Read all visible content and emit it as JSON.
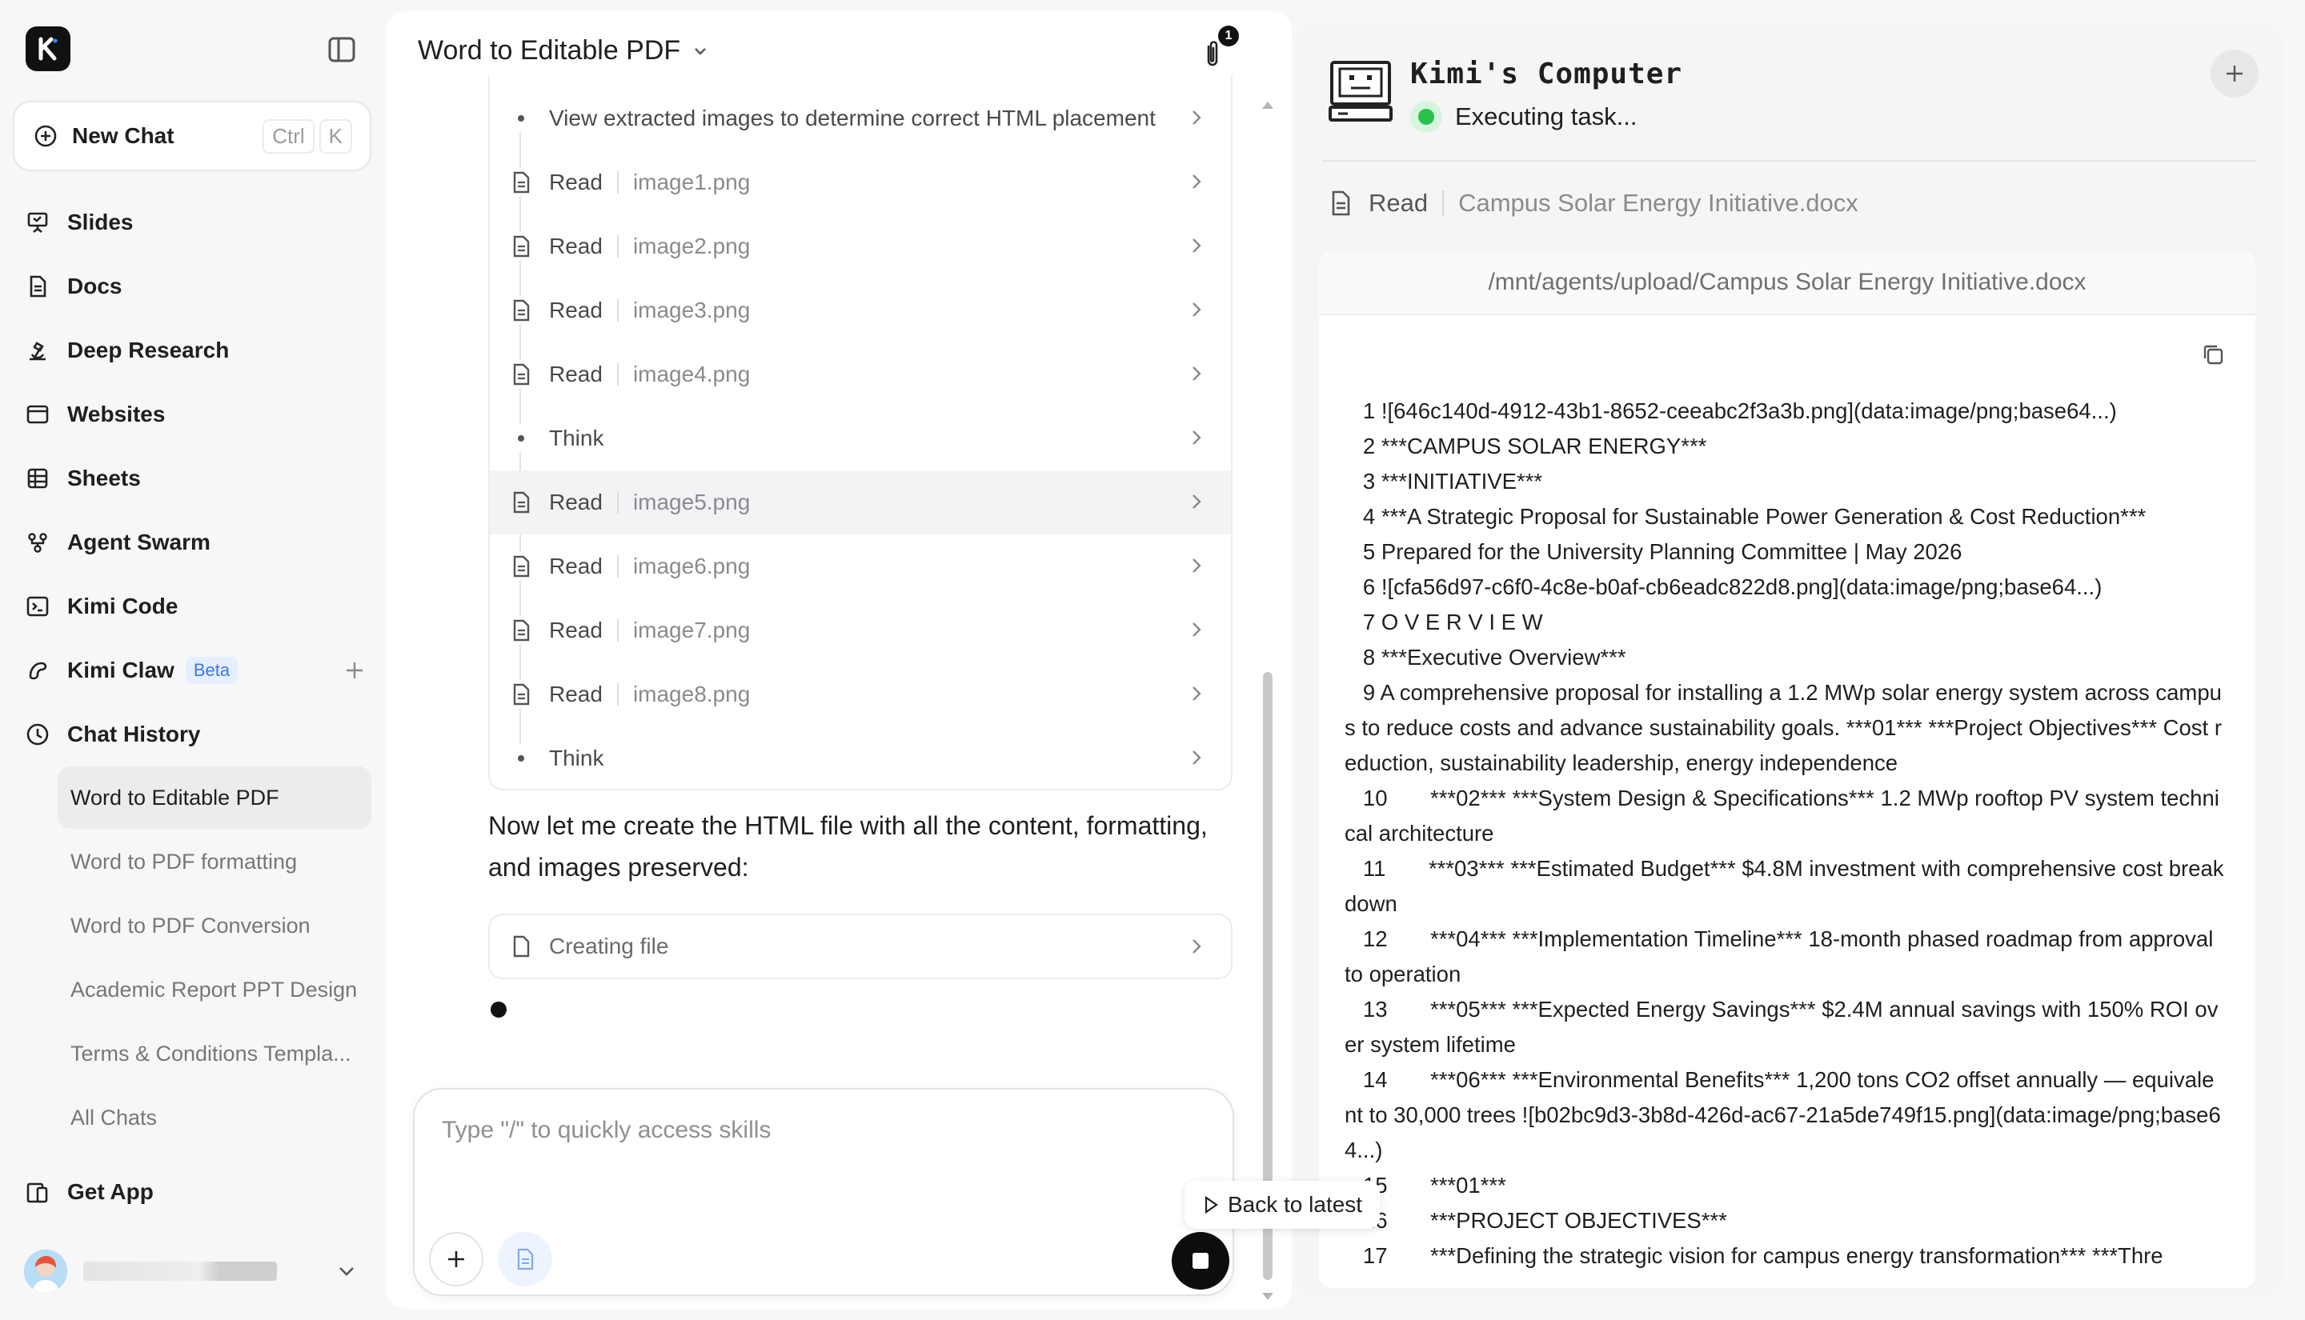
{
  "sidebar": {
    "new_chat": {
      "label": "New Chat",
      "shortcut_keys": [
        "Ctrl",
        "K"
      ]
    },
    "nav": [
      {
        "label": "Slides",
        "icon": "slides-icon"
      },
      {
        "label": "Docs",
        "icon": "docs-icon"
      },
      {
        "label": "Deep Research",
        "icon": "deep-research-icon"
      },
      {
        "label": "Websites",
        "icon": "websites-icon"
      },
      {
        "label": "Sheets",
        "icon": "sheets-icon"
      },
      {
        "label": "Agent Swarm",
        "icon": "agent-swarm-icon"
      },
      {
        "label": "Kimi Code",
        "icon": "code-icon"
      },
      {
        "label": "Kimi Claw",
        "icon": "claw-icon",
        "badge": "Beta"
      },
      {
        "label": "Chat History",
        "icon": "clock-icon"
      }
    ],
    "history": [
      "Word to Editable PDF",
      "Word to PDF formatting",
      "Word to PDF Conversion",
      "Academic Report PPT Design",
      "Terms & Conditions Templa...",
      "All Chats"
    ],
    "get_app": "Get App"
  },
  "chat": {
    "title": "Word to Editable PDF",
    "attachments_count": "1",
    "steps": [
      {
        "type": "dot",
        "text": "View extracted images to determine correct HTML placement"
      },
      {
        "type": "read",
        "text": "Read",
        "arg": "image1.png"
      },
      {
        "type": "read",
        "text": "Read",
        "arg": "image2.png"
      },
      {
        "type": "read",
        "text": "Read",
        "arg": "image3.png"
      },
      {
        "type": "read",
        "text": "Read",
        "arg": "image4.png"
      },
      {
        "type": "dot",
        "text": "Think"
      },
      {
        "type": "read",
        "text": "Read",
        "arg": "image5.png",
        "highlight": true
      },
      {
        "type": "read",
        "text": "Read",
        "arg": "image6.png"
      },
      {
        "type": "read",
        "text": "Read",
        "arg": "image7.png"
      },
      {
        "type": "read",
        "text": "Read",
        "arg": "image8.png"
      },
      {
        "type": "dot",
        "text": "Think"
      }
    ],
    "message": "Now let me create the HTML file with all the content, formatting, and images preserved:",
    "creating": "Creating file",
    "composer_placeholder": "Type \"/\" to quickly access skills"
  },
  "computer": {
    "title": "Kimi's Computer",
    "status": "Executing task...",
    "action": "Read",
    "file": "Campus Solar Energy Initiative.docx",
    "path": "/mnt/agents/upload/Campus Solar Energy Initiative.docx",
    "lines": [
      "   1 ![646c140d-4912-43b1-8652-ceeabc2f3a3b.png](data:image/png;base64...)",
      "   2 ***CAMPUS SOLAR ENERGY***",
      "   3 ***INITIATIVE***",
      "   4 ***A Strategic Proposal for Sustainable Power Generation & Cost Reduction***",
      "   5 Prepared for the University Planning Committee | May 2026",
      "   6 ![cfa56d97-c6f0-4c8e-b0af-cb6eadc822d8.png](data:image/png;base64...)",
      "   7 O V E R V I E W",
      "   8 ***Executive Overview***",
      "   9 A comprehensive proposal for installing a 1.2 MWp solar energy system across campus to reduce costs and advance sustainability goals. ***01*** ***Project Objectives*** Cost reduction, sustainability leadership, energy independence",
      "   10       ***02*** ***System Design & Specifications*** 1.2 MWp rooftop PV system technical architecture",
      "   11       ***03*** ***Estimated Budget*** $4.8M investment with comprehensive cost breakdown",
      "   12       ***04*** ***Implementation Timeline*** 18-month phased roadmap from approval to operation",
      "   13       ***05*** ***Expected Energy Savings*** $2.4M annual savings with 150% ROI over system lifetime",
      "   14       ***06*** ***Environmental Benefits*** 1,200 tons CO2 offset annually — equivalent to 30,000 trees ![b02bc9d3-3b8d-426d-ac67-21a5de749f15.png](data:image/png;base64...)",
      "   15       ***01***",
      "   16       ***PROJECT OBJECTIVES***",
      "   17       ***Defining the strategic vision for campus energy transformation*** ***Thre"
    ],
    "back_to_latest": "Back to latest"
  }
}
